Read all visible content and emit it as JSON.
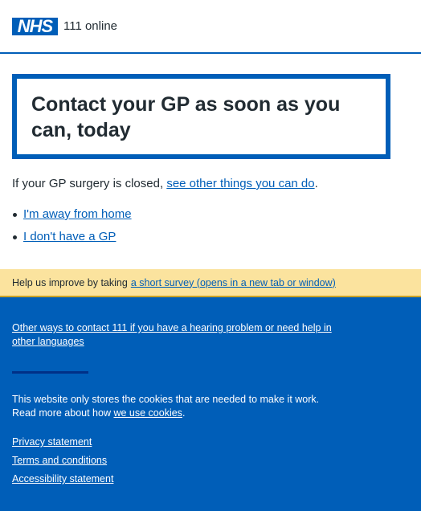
{
  "header": {
    "logo_text": "NHS",
    "service_name": "111 online"
  },
  "main": {
    "heading": "Contact your GP as soon as you can, today",
    "intro_prefix": "If your GP surgery is closed, ",
    "intro_link": "see other things you can do",
    "intro_suffix": ".",
    "links": [
      "I'm away from home",
      "I don't have a GP"
    ]
  },
  "survey": {
    "text": "Help us improve by taking",
    "link": "a short survey (opens in a new tab or window)"
  },
  "footer": {
    "other_ways_link": "Other ways to contact 111 if you have a hearing problem or need help in other languages",
    "cookies_text_1": "This website only stores the cookies that are needed to make it work.",
    "cookies_text_2_prefix": "Read more about how ",
    "cookies_link": "we use cookies",
    "cookies_text_2_suffix": ".",
    "links": [
      "Privacy statement",
      "Terms and conditions",
      "Accessibility statement"
    ]
  },
  "colors": {
    "nhs_blue": "#005eb8",
    "survey_bg": "#fbe39e",
    "text": "#212b32",
    "footer_divider": "#003087"
  }
}
